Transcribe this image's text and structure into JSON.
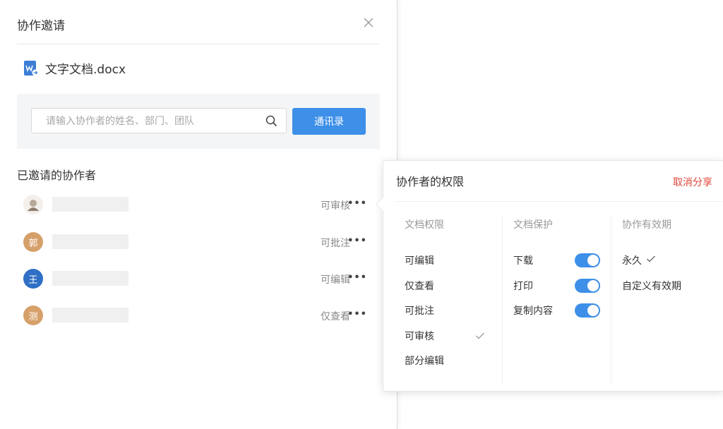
{
  "dialog": {
    "title": "协作邀请",
    "file_name": "文字文档.docx",
    "search_placeholder": "请输入协作者的姓名、部门、团队",
    "contacts_button": "通讯录",
    "invited_title": "已邀请的协作者"
  },
  "collaborators": [
    {
      "avatar_text": "",
      "avatar_color": "#d9c9b8",
      "permission": "可审核"
    },
    {
      "avatar_text": "郭",
      "avatar_color": "#d6a06a",
      "permission": "可批注"
    },
    {
      "avatar_text": "王",
      "avatar_color": "#2f6fc4",
      "permission": "可编辑"
    },
    {
      "avatar_text": "测",
      "avatar_color": "#d6a06a",
      "permission": "仅查看"
    }
  ],
  "popover": {
    "title": "协作者的权限",
    "cancel_share": "取消分享",
    "doc_permission": {
      "header": "文档权限",
      "options": [
        "可编辑",
        "仅查看",
        "可批注",
        "可审核",
        "部分编辑"
      ],
      "selected": "可审核"
    },
    "doc_protection": {
      "header": "文档保护",
      "items": [
        {
          "label": "下载",
          "enabled": true
        },
        {
          "label": "打印",
          "enabled": true
        },
        {
          "label": "复制内容",
          "enabled": true
        }
      ]
    },
    "validity": {
      "header": "协作有效期",
      "options": [
        "永久",
        "自定义有效期"
      ],
      "selected": "永久"
    }
  },
  "colors": {
    "accent": "#3d8fe8",
    "danger": "#e0463a"
  }
}
